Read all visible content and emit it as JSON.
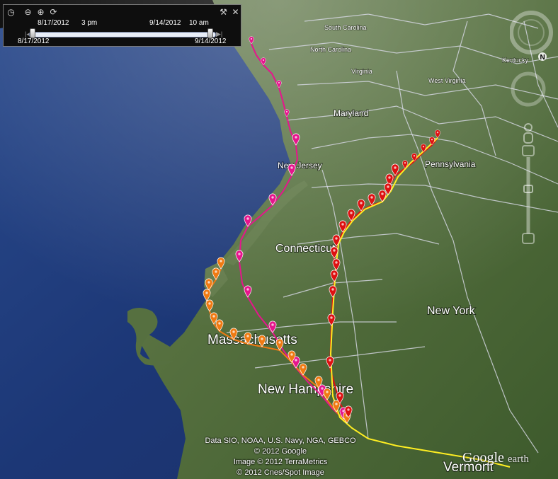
{
  "time_slider": {
    "current_start": "8/17/2012",
    "current_start_time": "3 pm",
    "current_end": "9/14/2012",
    "current_end_time": "10 am",
    "range_start": "8/17/2012",
    "range_end": "9/14/2012",
    "icons": [
      "clock-icon",
      "zoom-out-icon",
      "zoom-in-icon",
      "reset-time-icon",
      "settings-wrench-icon",
      "close-icon"
    ]
  },
  "labels": {
    "south_carolina": "South Carolina",
    "north_carolina": "North Carolina",
    "virginia": "Virginia",
    "west_virginia": "West Virginia",
    "kentucky": "Kentucky",
    "maryland": "Maryland",
    "new_jersey": "New Jersey",
    "pennsylvania": "Pennsylvania",
    "connecticut": "Connecticut",
    "new_york": "New York",
    "massachusetts": "Massachusetts",
    "new_hampshire": "New Hampshire",
    "vermont": "Vermont"
  },
  "attribution": {
    "line1": "Data SIO, NOAA, U.S. Navy, NGA, GEBCO",
    "line2": "© 2012 Google",
    "line3": "Image © 2012 TerraMetrics",
    "line4": "© 2012 Cnes/Spot Image"
  },
  "logo": {
    "main": "Google",
    "sub": "earth"
  },
  "compass": {
    "north": "N"
  },
  "colors": {
    "track_magenta": "#e6158c",
    "track_orange": "#f07a12",
    "track_red": "#dd1111",
    "track_yellow": "#ffee22",
    "ocean": "#1d3a7a",
    "land": "#4a6a36"
  }
}
